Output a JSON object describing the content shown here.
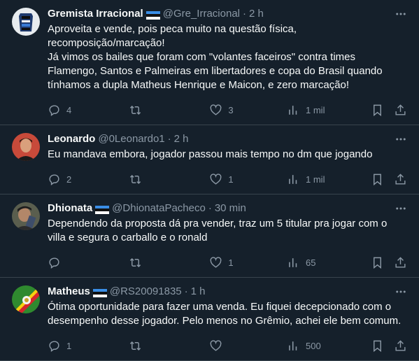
{
  "tweets": [
    {
      "name": "Gremista Irracional",
      "handle": "@Gre_Irracional",
      "separator": "·",
      "time": "2 h",
      "text": "Aproveita e vende, pois peca muito na questão física, recomposição/marcação!\nJá vimos os bailes que foram com \"volantes faceiros\" contra times Flamengo, Santos e Palmeiras em libertadores e copa do Brasil quando tínhamos a dupla Matheus Henrique e Maicon, e zero marcação!",
      "replies": "4",
      "retweets": "",
      "likes": "3",
      "views": "1 mil"
    },
    {
      "name": "Leonardo",
      "handle": "@0Leonardo1",
      "separator": "·",
      "time": "2 h",
      "text": "Eu mandava embora, jogador passou mais tempo no dm que jogando",
      "replies": "2",
      "retweets": "",
      "likes": "1",
      "views": "1 mil"
    },
    {
      "name": "Dhionata",
      "handle": "@DhionataPacheco",
      "separator": "·",
      "time": "30 min",
      "text": "Dependendo da proposta dá pra vender, traz um 5 titular pra jogar com o villa e segura o carballo e o ronald",
      "replies": "",
      "retweets": "",
      "likes": "1",
      "views": "65"
    },
    {
      "name": "Matheus",
      "handle": "@RS20091835",
      "separator": "·",
      "time": "1 h",
      "text": "Ótima oportunidade para fazer uma venda. Eu fiquei decepcionado com o desempenho desse jogador. Pelo menos no Grêmio, achei ele bem comum.",
      "replies": "1",
      "retweets": "",
      "likes": "",
      "views": "500"
    }
  ],
  "colors": {
    "background": "#15202b",
    "text": "#f7f9f9",
    "muted": "#8b98a5",
    "divider": "#38444d"
  },
  "icons": [
    "more-icon",
    "reply-icon",
    "retweet-icon",
    "like-icon",
    "views-icon",
    "bookmark-icon",
    "share-icon",
    "gremio-flag-icon"
  ]
}
